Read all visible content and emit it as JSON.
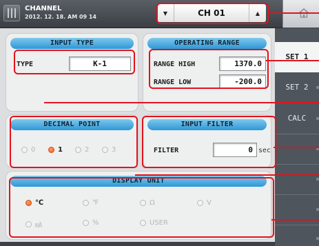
{
  "header": {
    "title": "CHANNEL",
    "datetime": "2012. 12. 18.  AM 09 14",
    "channel_value": "CH 01",
    "prev_icon": "triangle-down-icon",
    "next_icon": "triangle-up-icon",
    "home_icon": "home-icon"
  },
  "input_type": {
    "title": "INPUT TYPE",
    "type_label": "TYPE",
    "type_value": "K-1"
  },
  "operating_range": {
    "title": "OPERATING RANGE",
    "high_label": "RANGE HIGH",
    "high_value": "1370.0",
    "low_label": "RANGE LOW",
    "low_value": "-200.0"
  },
  "decimal_point": {
    "title": "DECIMAL POINT",
    "options": [
      "0",
      "1",
      "2",
      "3"
    ],
    "selected": "1"
  },
  "input_filter": {
    "title": "INPUT FILTER",
    "filter_label": "FILTER",
    "filter_value": "0",
    "unit": "sec"
  },
  "display_unit": {
    "title": "DISPLAY UNIT",
    "options": [
      "℃",
      "℉",
      "Ω",
      "V",
      "㎃",
      "%",
      "USER"
    ],
    "selected": "℃"
  },
  "tabs": [
    "SET 1",
    "SET 2",
    "CALC"
  ],
  "active_tab": "SET 1",
  "colors": {
    "highlight": "#e3121c",
    "title_bar": "#2e97d6",
    "radio_on": "#ee5a22"
  }
}
